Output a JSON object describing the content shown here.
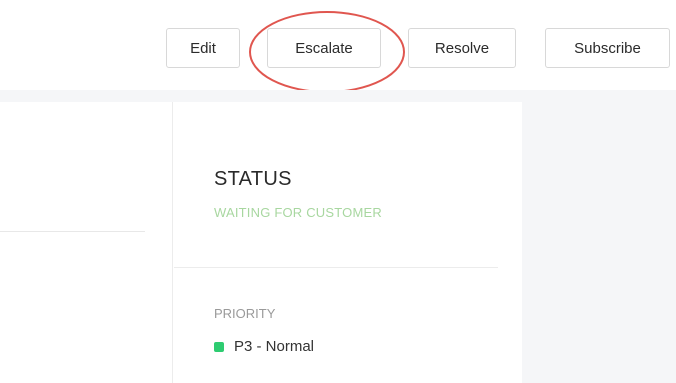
{
  "toolbar": {
    "edit_label": "Edit",
    "escalate_label": "Escalate",
    "resolve_label": "Resolve",
    "subscribe_label": "Subscribe"
  },
  "status": {
    "heading": "STATUS",
    "value": "WAITING FOR CUSTOMER",
    "value_color": "#a8d7a0"
  },
  "priority": {
    "label": "PRIORITY",
    "value": "P3 - Normal",
    "indicator_color": "#2ecc71"
  },
  "annotation": {
    "highlight_color": "#e0564f",
    "highlighted_item": "Escalate"
  }
}
